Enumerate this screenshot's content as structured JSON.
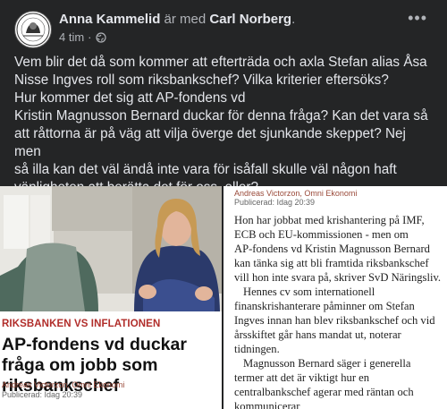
{
  "post": {
    "author": "Anna Kammelid",
    "connector": "är med",
    "tagged": "Carl Norberg",
    "time": "4 tim",
    "privacy_icon": "globe-icon",
    "menu_icon": "more-dots-icon",
    "text_lines": [
      "Vem blir det då som kommer att efterträda och axla Stefan alias Åsa",
      "Nisse Ingves roll som riksbankschef? Vilka kriterier eftersöks?",
      "Hur kommer det sig att AP-fondens vd",
      "Kristin Magnusson Bernard duckar för denna fråga? Kan det vara så",
      "att råttorna är på väg att vilja överge det sjunkande skeppet? Nej men",
      "så illa kan det väl ändå inte vara för isåfall skulle väl någon haft",
      "vänligheten att berätta det för oss, eller?"
    ]
  },
  "article_left": {
    "kicker": "RIKSBANKEN VS INFLATIONEN",
    "headline": "AP-fondens vd duckar fråga om jobb som riksbankschef",
    "byline": "Andreas Victorzon, Omni Ekonomi",
    "published": "Publicerad: Idag 20:39"
  },
  "article_right": {
    "byline": "Andreas Victorzon, Omni Ekonomi",
    "published": "Publicerad: Idag 20:39",
    "body_lines": [
      "Hon har jobbat med krishantering på IMF,",
      "ECB och EU-kommissionen - men om",
      "AP-fondens vd Kristin Magnusson Bernard",
      "kan tänka sig att bli framtida riksbankschef",
      "vill hon inte svara på, skriver SvD Näringsliv.",
      "Hennes cv som internationell",
      "finanskrishanterare påminner om Stefan",
      "Ingves innan han blev riksbankschef och vid",
      "årsskiftet går hans mandat ut, noterar",
      "tidningen.",
      "Magnusson Bernard säger i generella",
      "termer att det är viktigt hur en",
      "centralbankschef agerar med räntan och",
      "kommunicerar"
    ]
  }
}
